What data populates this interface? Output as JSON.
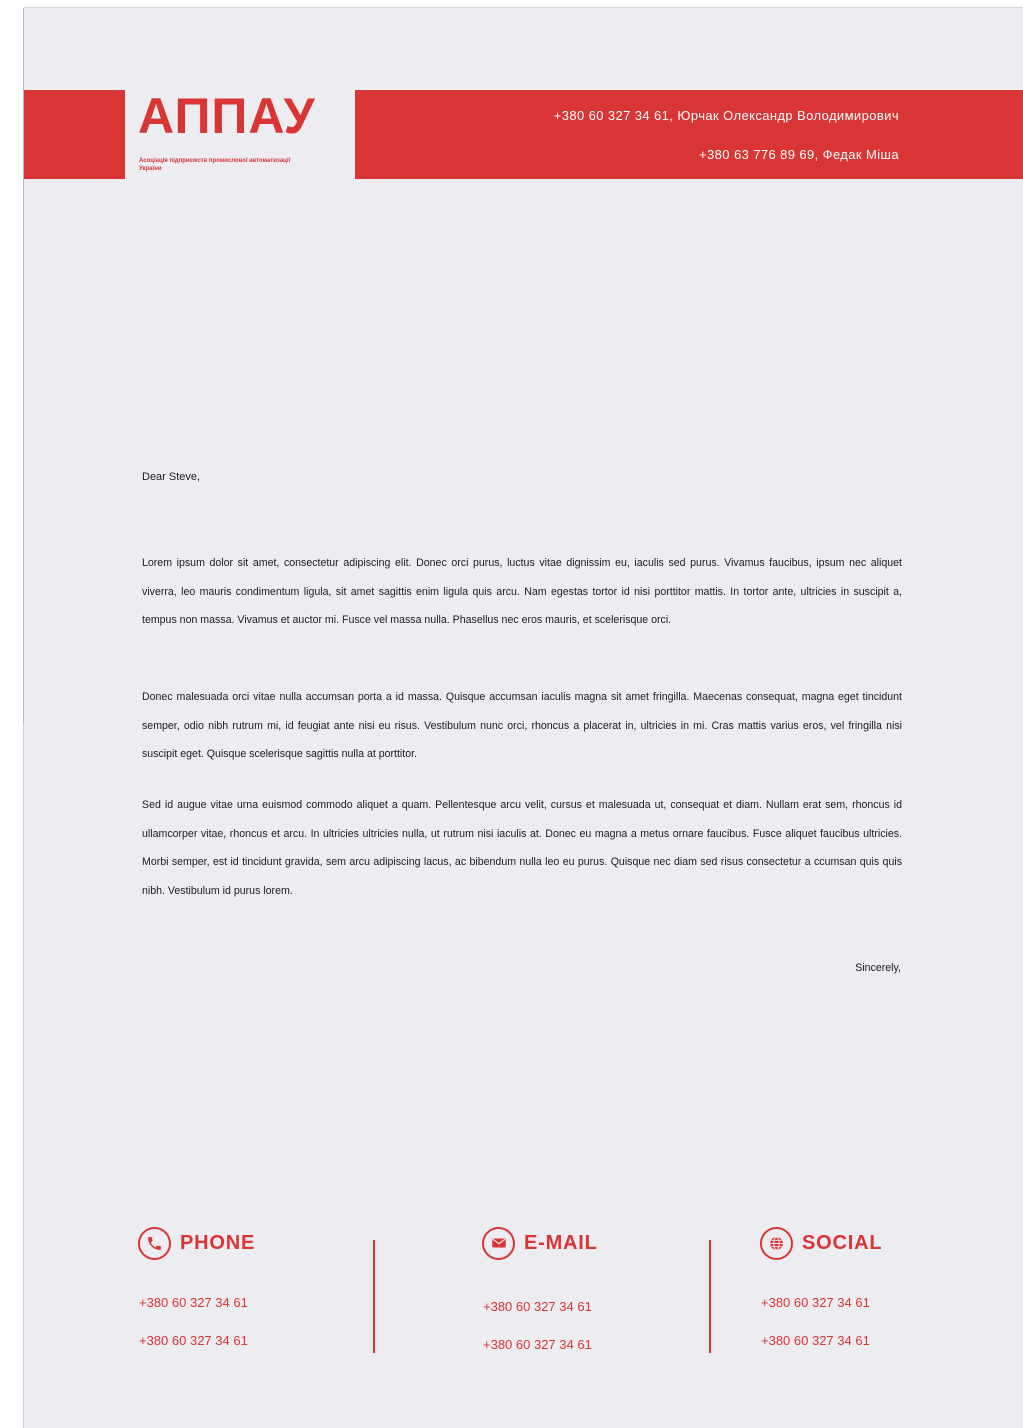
{
  "header": {
    "logo": "АППАУ",
    "logo_subtitle": "Асоціація підприємств промислової автоматизації України",
    "contact_1": "+380 60 327 34 61, Юрчак Олександр Володимирович",
    "contact_2": "+380 63 776 89 69, Федак Міша",
    "brand_color": "#d93535"
  },
  "letter": {
    "greeting": "Dear Steve,",
    "paragraphs": [
      "Lorem ipsum dolor sit amet, consectetur adipiscing elit. Donec orci purus, luctus vitae dignissim eu, iaculis sed purus. Vivamus faucibus, ipsum nec aliquet viverra, leo mauris condimentum ligula, sit amet sagittis enim ligula quis arcu. Nam egestas tortor id nisi porttitor mattis. In tortor ante, ultricies in suscipit a, tempus non massa. Vivamus et auctor mi. Fusce vel massa nulla. Phasellus nec eros mauris, et scelerisque orci.",
      "Donec malesuada orci vitae nulla accumsan porta a id massa. Quisque accumsan iaculis magna sit amet fringilla. Maecenas consequat, magna eget tincidunt semper, odio nibh rutrum mi, id feugiat ante nisi eu risus. Vestibulum nunc orci, rhoncus a placerat in, ultricies in mi. Cras mattis varius eros, vel fringilla nisi suscipit eget. Quisque scelerisque sagittis nulla at porttitor.",
      "Sed id augue vitae urna euismod commodo aliquet a quam. Pellentesque arcu velit, cursus et malesuada ut, consequat et diam. Nullam erat sem, rhoncus id ullamcorper vitae, rhoncus et arcu. In ultricies ultricies nulla, ut rutrum nisi iaculis at. Donec eu magna a metus ornare faucibus. Fusce aliquet faucibus ultricies. Morbi semper, est id tincidunt gravida, sem arcu adipiscing lacus, ac bibendum nulla leo eu purus. Quisque nec diam sed risus consectetur a ccumsan quis quis nibh. Vestibulum id purus lorem."
    ],
    "closing": "Sincerely,"
  },
  "footer": {
    "phone": {
      "title": "PHONE",
      "icon": "phone-icon",
      "items": [
        "+380 60 327 34 61",
        "+380 60 327 34 61"
      ]
    },
    "email": {
      "title": "E-MAIL",
      "icon": "envelope-icon",
      "items": [
        "+380 60 327 34 61",
        "+380 60 327 34 61"
      ]
    },
    "social": {
      "title": "SOCIAL",
      "icon": "globe-icon",
      "items": [
        "+380 60 327 34 61",
        "+380 60 327 34 61"
      ]
    }
  }
}
